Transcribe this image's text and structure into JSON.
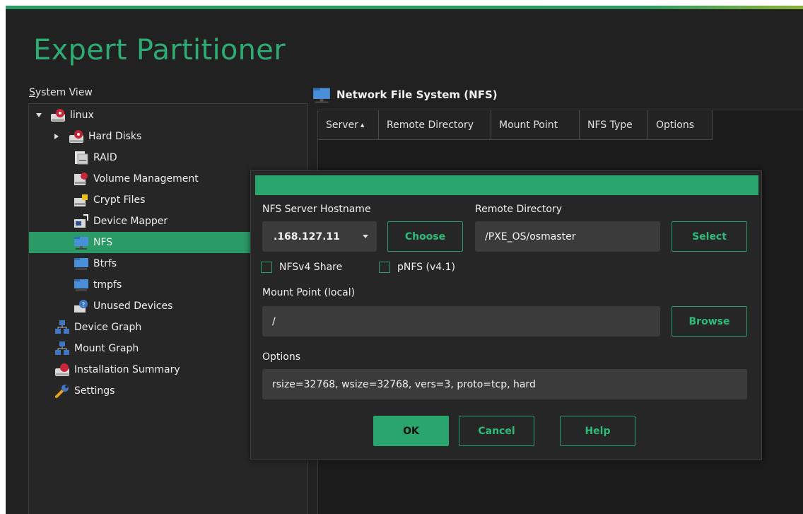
{
  "app": {
    "title": "Expert Partitioner"
  },
  "system_view": {
    "label": "System View",
    "label_mnemonic": "S",
    "label_rest": "ystem View",
    "items": [
      {
        "label": "linux",
        "icon": "hard-drive-icon",
        "expanded": true
      },
      {
        "label": "Hard Disks",
        "icon": "hard-drive-icon",
        "collapsed": true
      },
      {
        "label": "RAID",
        "icon": "raid-icon"
      },
      {
        "label": "Volume Management",
        "icon": "hard-drive-icon"
      },
      {
        "label": "Crypt Files",
        "icon": "crypt-file-icon"
      },
      {
        "label": "Device Mapper",
        "icon": "device-mapper-icon"
      },
      {
        "label": "NFS",
        "icon": "network-folder-icon",
        "selected": true
      },
      {
        "label": "Btrfs",
        "icon": "folder-icon"
      },
      {
        "label": "tmpfs",
        "icon": "folder-icon"
      },
      {
        "label": "Unused Devices",
        "icon": "unused-devices-icon"
      },
      {
        "label": "Device Graph",
        "icon": "graph-icon"
      },
      {
        "label": "Mount Graph",
        "icon": "graph-icon"
      },
      {
        "label": "Installation Summary",
        "icon": "hard-drive-icon"
      },
      {
        "label": "Settings",
        "icon": "wrench-icon"
      }
    ]
  },
  "nfs_panel": {
    "title": "Network File System (NFS)",
    "columns": [
      "Server",
      "Remote Directory",
      "Mount Point",
      "NFS Type",
      "Options"
    ],
    "sort_indicator": "▴"
  },
  "dialog": {
    "hostname_label": "NFS Server Hostname",
    "hostname_value": ".168.127.11",
    "choose_button": "Choose",
    "remote_dir_label": "Remote Directory",
    "remote_dir_value": "/PXE_OS/osmaster",
    "select_button": "Select",
    "nfsv4_label": "NFSv4 Share",
    "nfsv4_checked": false,
    "pnfs_label": "pNFS (v4.1)",
    "pnfs_checked": false,
    "mount_point_label": "Mount Point (local)",
    "mount_point_value": "/",
    "browse_button": "Browse",
    "options_label": "Options",
    "options_value": "rsize=32768, wsize=32768, vers=3, proto=tcp, hard",
    "ok_button": "OK",
    "cancel_button": "Cancel",
    "help_button": "Help"
  },
  "colors": {
    "accent": "#2aa56d",
    "background": "#212121",
    "title": "#2dab72"
  }
}
